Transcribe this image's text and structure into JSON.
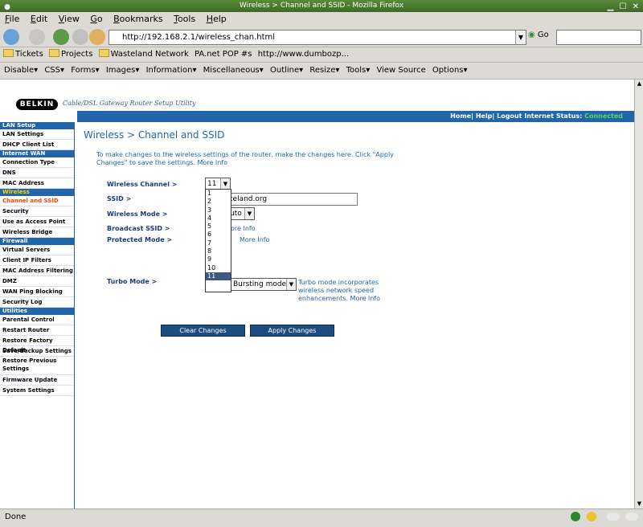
{
  "window": {
    "title": "Wireless > Channel and SSID - Mozilla Firefox"
  },
  "menu": [
    "File",
    "Edit",
    "View",
    "Go",
    "Bookmarks",
    "Tools",
    "Help"
  ],
  "nav": {
    "url": "http://192.168.2.1/wireless_chan.html",
    "go_label": "Go"
  },
  "bookmarks": [
    "Tickets",
    "Projects",
    "Wasteland Network",
    "PA.net POP #s",
    "http://www.dumbozp..."
  ],
  "webdev": [
    "Disable▾",
    "CSS▾",
    "Forms▾",
    "Images▾",
    "Information▾",
    "Miscellaneous▾",
    "Outline▾",
    "Resize▾",
    "Tools▾",
    "View Source",
    "Options▾"
  ],
  "page": {
    "logo": "BELKIN",
    "utility": "Cable/DSL Gateway Router Setup Utility",
    "topnav": "Home| Help| Logout   Internet Status:",
    "internet_status": "Connected",
    "title": "Wireless > Channel and SSID",
    "intro": "To make changes to the wireless settings of the router, make the changes here. Click \"Apply Changes\" to save the settings.",
    "intro_more": "More Info",
    "labels": {
      "channel": "Wireless Channel >",
      "ssid": "SSID >",
      "mode": "Wireless Mode >",
      "broadcast": "Broadcast SSID >",
      "protected": "Protected Mode >",
      "turbo": "Turbo Mode >"
    },
    "channel_value": "11",
    "ssid_value": "teland.org",
    "mode_value": "uto",
    "broadcast_more": "ore Info",
    "protected_more": "More Info",
    "turbo_value": "Bursting mode",
    "turbo_desc": "Turbo mode incorporates wireless network speed enhancements.",
    "turbo_more": "More Info",
    "clear_btn": "Clear Changes",
    "apply_btn": "Apply Changes",
    "channel_options": [
      "1",
      "2",
      "3",
      "4",
      "5",
      "6",
      "7",
      "8",
      "9",
      "10",
      "11"
    ]
  },
  "sidebar": {
    "lan_setup": "LAN Setup",
    "lan": [
      "LAN Settings",
      "DHCP Client List"
    ],
    "internet_wan": "Internet WAN",
    "wan": [
      "Connection Type",
      "DNS",
      "MAC Address"
    ],
    "wireless": "Wireless",
    "wl": [
      "Channel and SSID",
      "Security",
      "Use as Access Point",
      "Wireless Bridge"
    ],
    "firewall": "Firewall",
    "fw": [
      "Virtual Servers",
      "Client IP Filters",
      "MAC Address Filtering",
      "DMZ",
      "WAN Ping Blocking",
      "Security Log"
    ],
    "utilities": "Utilities",
    "ut": [
      "Parental Control",
      "Restart Router",
      "Restore Factory Default",
      "Save/Backup Settings",
      "Restore Previous Settings",
      "Firmware Update",
      "System Settings"
    ]
  },
  "status": {
    "text": "Done"
  }
}
